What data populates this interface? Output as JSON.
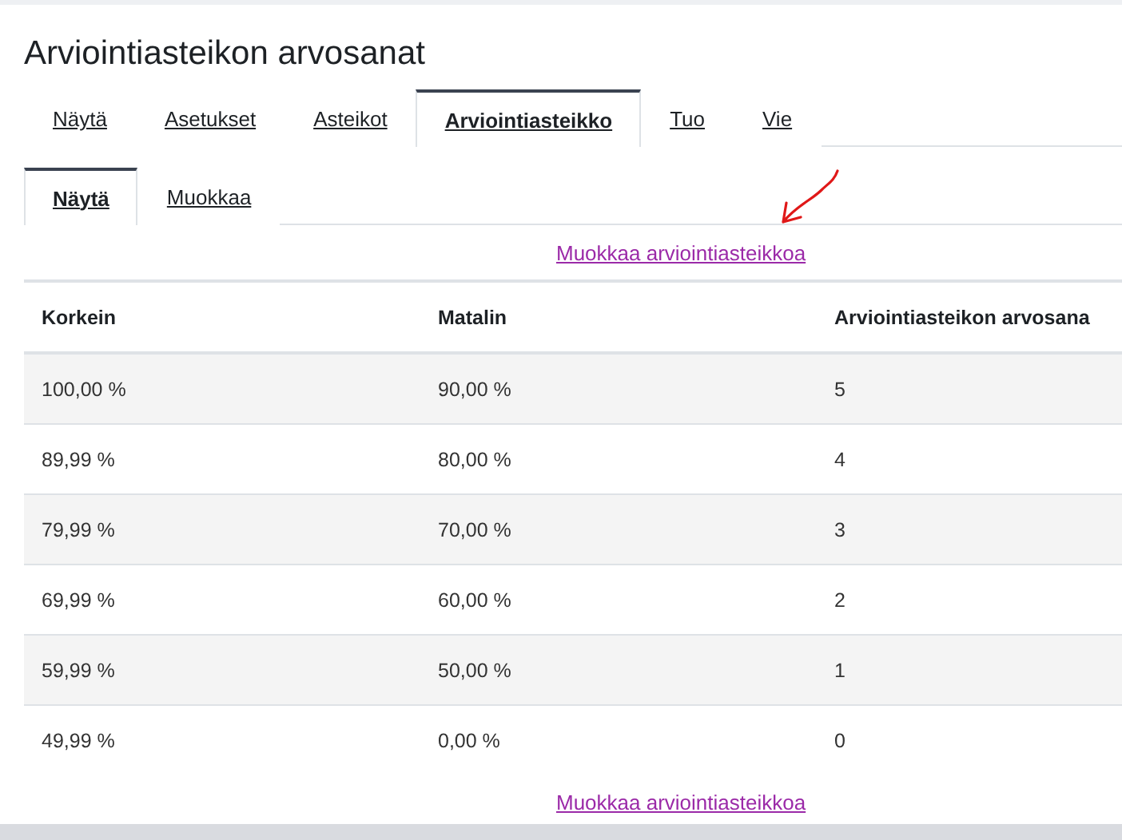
{
  "title": "Arviointiasteikon arvosanat",
  "tabs": [
    {
      "label": "Näytä",
      "selected": false
    },
    {
      "label": "Asetukset",
      "selected": false
    },
    {
      "label": "Asteikot",
      "selected": false
    },
    {
      "label": "Arviointiasteikko",
      "selected": true
    },
    {
      "label": "Tuo",
      "selected": false
    },
    {
      "label": "Vie",
      "selected": false
    }
  ],
  "subtabs": [
    {
      "label": "Näytä",
      "selected": true
    },
    {
      "label": "Muokkaa",
      "selected": false
    }
  ],
  "edit_link_top": "Muokkaa arviointiasteikkoa",
  "table": {
    "columns": [
      "Korkein",
      "Matalin",
      "Arviointiasteikon arvosana"
    ],
    "rows": [
      [
        "100,00 %",
        "90,00 %",
        "5"
      ],
      [
        "89,99 %",
        "80,00 %",
        "4"
      ],
      [
        "79,99 %",
        "70,00 %",
        "3"
      ],
      [
        "69,99 %",
        "60,00 %",
        "2"
      ],
      [
        "59,99 %",
        "50,00 %",
        "1"
      ],
      [
        "49,99 %",
        "0,00 %",
        "0"
      ]
    ]
  },
  "edit_link_bottom": "Muokkaa arviointiasteikkoa"
}
